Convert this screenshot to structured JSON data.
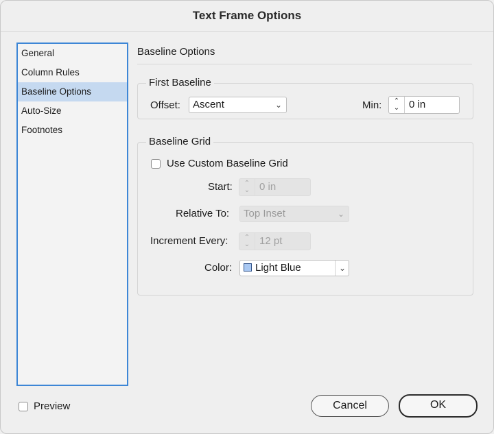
{
  "dialog": {
    "title": "Text Frame Options"
  },
  "sidebar": {
    "items": [
      {
        "label": "General"
      },
      {
        "label": "Column Rules"
      },
      {
        "label": "Baseline Options"
      },
      {
        "label": "Auto-Size"
      },
      {
        "label": "Footnotes"
      }
    ],
    "selected": "Baseline Options"
  },
  "main": {
    "section_title": "Baseline Options",
    "first_baseline": {
      "title": "First Baseline",
      "offset_label": "Offset:",
      "offset_value": "Ascent",
      "min_label": "Min:",
      "min_value": "0 in"
    },
    "baseline_grid": {
      "title": "Baseline Grid",
      "use_custom_label": "Use Custom Baseline Grid",
      "use_custom_checked": false,
      "start_label": "Start:",
      "start_value": "0 in",
      "relative_label": "Relative To:",
      "relative_value": "Top Inset",
      "increment_label": "Increment Every:",
      "increment_value": "12 pt",
      "color_label": "Color:",
      "color_value": "Light Blue",
      "color_swatch": "#a9c8f2"
    }
  },
  "footer": {
    "preview_label": "Preview",
    "preview_checked": false,
    "cancel_label": "Cancel",
    "ok_label": "OK"
  }
}
